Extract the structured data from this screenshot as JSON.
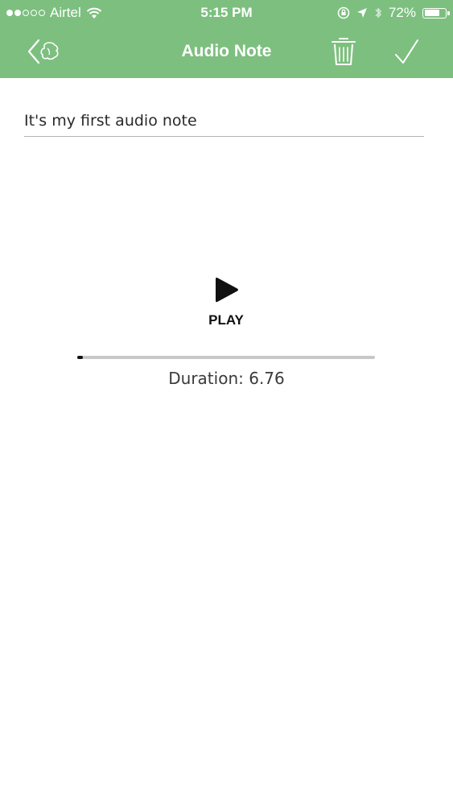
{
  "status_bar": {
    "carrier": "Airtel",
    "time": "5:15 PM",
    "battery_percent": "72%",
    "battery_level": 0.72,
    "signal_bars_filled": 2,
    "signal_bars_total": 5
  },
  "nav": {
    "title": "Audio Note",
    "back_icon": "back-chevron-logo-icon",
    "delete_icon": "trash-icon",
    "confirm_icon": "checkmark-icon"
  },
  "note": {
    "title_value": "It's my first audio note"
  },
  "player": {
    "play_label": "PLAY",
    "progress": 0.02,
    "duration_label": "Duration:",
    "duration_value": "6.76"
  },
  "colors": {
    "accent": "#7dbf7f",
    "text": "#2a2a2a"
  }
}
